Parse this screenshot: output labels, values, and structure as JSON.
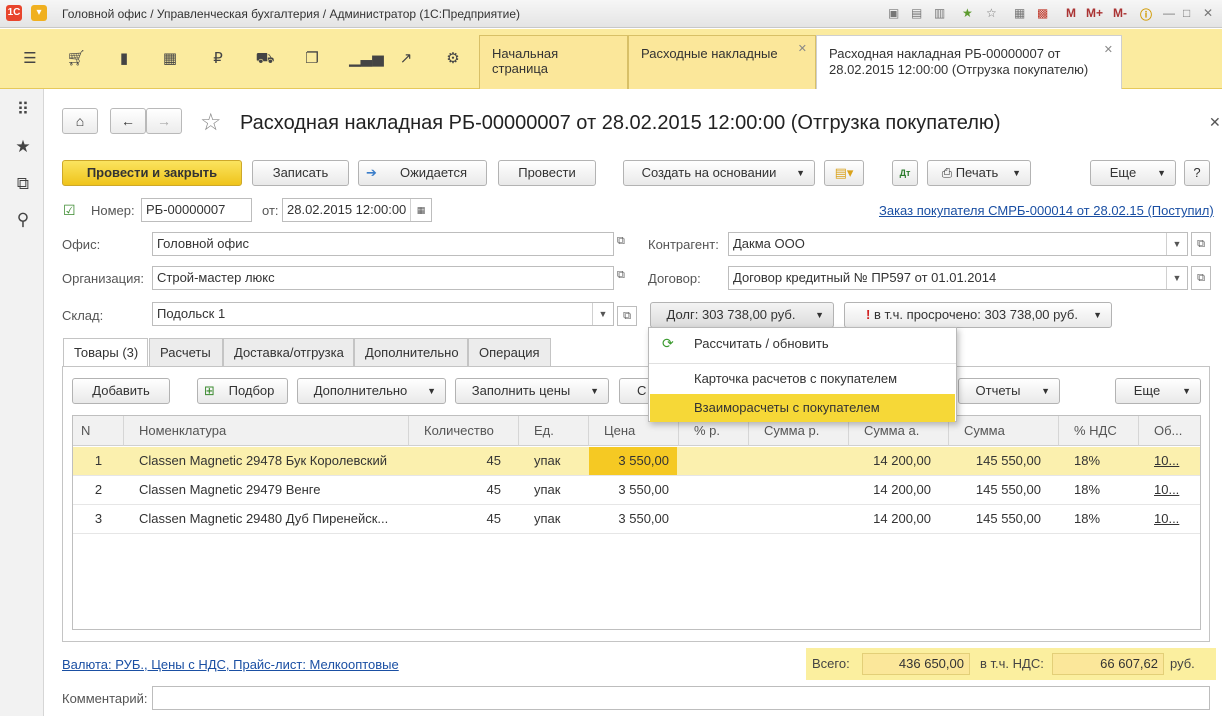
{
  "window": {
    "title": "Головной офис / Управленческая бухгалтерия / Администратор  (1С:Предприятие)",
    "toolbar_right": [
      "M",
      "M+",
      "M-"
    ]
  },
  "tabs": [
    {
      "label": "Начальная страница"
    },
    {
      "label": "Расходные накладные"
    },
    {
      "label": "Расходная накладная РБ-00000007 от 28.02.2015 12:00:00 (Отгрузка покупателю)",
      "line1": "Расходная накладная РБ-00000007 от",
      "line2": "28.02.2015 12:00:00 (Отгрузка покупателю)"
    }
  ],
  "document": {
    "title": "Расходная накладная РБ-00000007 от 28.02.2015 12:00:00 (Отгрузка покупателю)"
  },
  "toolbar": {
    "post_close": "Провести и закрыть",
    "save": "Записать",
    "expected": "Ожидается",
    "post": "Провести",
    "create_based": "Создать на основании",
    "print": "Печать",
    "more": "Еще",
    "help": "?"
  },
  "header": {
    "number_label": "Номер:",
    "number_value": "РБ-00000007",
    "date_label": "от:",
    "date_value": "28.02.2015 12:00:00",
    "order_link": "Заказ покупателя СМРБ-000014 от 28.02.15 (Поступил)",
    "office_label": "Офис:",
    "office_value": "Головной офис",
    "org_label": "Организация:",
    "org_value": "Строй-мастер люкс",
    "warehouse_label": "Склад:",
    "warehouse_value": "Подольск 1",
    "contractor_label": "Контрагент:",
    "contractor_value": "Дакма ООО",
    "contract_label": "Договор:",
    "contract_value": "Договор кредитный № ПР597 от 01.01.2014",
    "debt_button": "Долг: 303 738,00 руб.",
    "overdue_button": "в т.ч. просрочено: 303 738,00 руб."
  },
  "popup": {
    "items": [
      "Рассчитать / обновить",
      "Карточка расчетов с покупателем",
      "Взаиморасчеты с покупателем"
    ]
  },
  "subtabs": [
    "Товары (3)",
    "Расчеты",
    "Доставка/отгрузка",
    "Дополнительно",
    "Операция"
  ],
  "goods_toolbar": {
    "add": "Добавить",
    "pick": "Подбор",
    "additional": "Дополнительно",
    "fill_prices": "Заполнить цены",
    "partial": "С",
    "reports": "Отчеты",
    "more": "Еще"
  },
  "table": {
    "columns": [
      "N",
      "Номенклатура",
      "Количество",
      "Ед.",
      "Цена",
      "% р.",
      "Сумма р.",
      "Сумма а.",
      "Сумма",
      "% НДС",
      "Об..."
    ],
    "rows": [
      [
        "1",
        "Classen Magnetic 29478 Бук Королевский",
        "45",
        "упак",
        "3 550,00",
        "",
        "",
        "14 200,00",
        "145 550,00",
        "18%",
        "10..."
      ],
      [
        "2",
        "Classen Magnetic 29479 Венге",
        "45",
        "упак",
        "3 550,00",
        "",
        "",
        "14 200,00",
        "145 550,00",
        "18%",
        "10..."
      ],
      [
        "3",
        "Classen Magnetic 29480 Дуб Пиренейск...",
        "45",
        "упак",
        "3 550,00",
        "",
        "",
        "14 200,00",
        "145 550,00",
        "18%",
        "10..."
      ]
    ]
  },
  "footer": {
    "currency_link": "Валюта: РУБ., Цены с НДС, Прайс-лист: Мелкооптовые",
    "total_label": "Всего:",
    "total_value": "436 650,00",
    "vat_label": "в т.ч. НДС:",
    "vat_value": "66 607,62",
    "currency": "руб.",
    "comment_label": "Комментарий:"
  },
  "colors": {
    "accent_yellow": "#f5c923",
    "section_bar": "#fbeb9f",
    "link": "#1a4fa3"
  }
}
